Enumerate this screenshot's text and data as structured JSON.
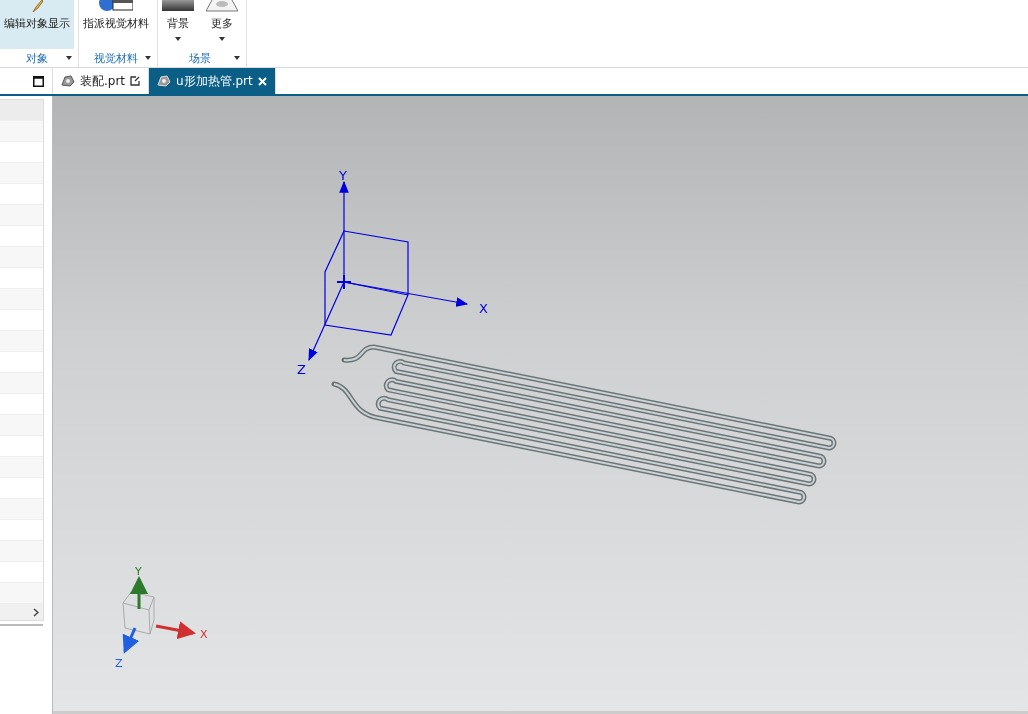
{
  "ribbon": {
    "groups": [
      {
        "label": "对象",
        "buttons": [
          {
            "label": "编辑对象显示",
            "kind": "brush",
            "selected": true,
            "dropdown": false
          }
        ]
      },
      {
        "label": "视觉材料",
        "buttons": [
          {
            "label": "指派视觉材料",
            "kind": "material",
            "selected": false,
            "dropdown": false
          }
        ]
      },
      {
        "label": "场景",
        "buttons": [
          {
            "label": "背景",
            "kind": "background",
            "selected": false,
            "dropdown": true
          },
          {
            "label": "更多",
            "kind": "more",
            "selected": false,
            "dropdown": true
          }
        ]
      }
    ]
  },
  "tabs": [
    {
      "label": "装配.prt",
      "selected": false
    },
    {
      "label": "u形加热管.prt",
      "selected": true
    }
  ],
  "viewport": {
    "wcs_labels": [
      "X",
      "Y",
      "Z"
    ],
    "triad_labels": [
      "X",
      "Y",
      "Z"
    ]
  }
}
